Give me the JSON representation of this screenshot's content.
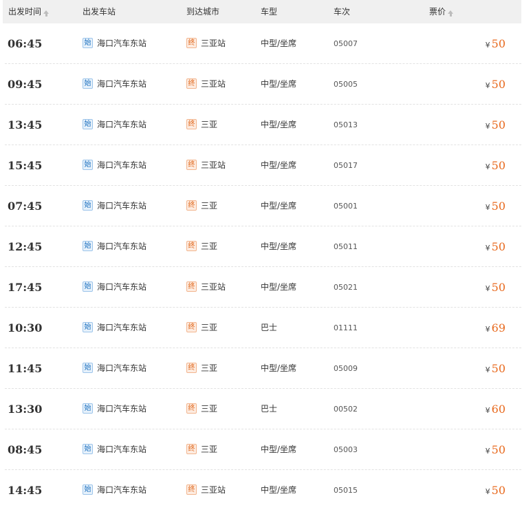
{
  "header": {
    "depart_time": "出发时间",
    "depart_station": "出发车站",
    "arrive_city": "到达城市",
    "bus_type": "车型",
    "trip_no": "车次",
    "price": "票价"
  },
  "badges": {
    "start": "始",
    "end": "终"
  },
  "currency": "¥",
  "colors": {
    "price": "#e8691d",
    "start_badge": "#1a6fbf",
    "end_badge": "#e0661a",
    "header_bg": "#f0f0f0"
  },
  "rows": [
    {
      "time": "06:45",
      "from": "海口汽车东站",
      "to": "三亚站",
      "type": "中型/坐席",
      "trip": "05007",
      "price": "50"
    },
    {
      "time": "09:45",
      "from": "海口汽车东站",
      "to": "三亚站",
      "type": "中型/坐席",
      "trip": "05005",
      "price": "50"
    },
    {
      "time": "13:45",
      "from": "海口汽车东站",
      "to": "三亚",
      "type": "中型/坐席",
      "trip": "05013",
      "price": "50"
    },
    {
      "time": "15:45",
      "from": "海口汽车东站",
      "to": "三亚站",
      "type": "中型/坐席",
      "trip": "05017",
      "price": "50"
    },
    {
      "time": "07:45",
      "from": "海口汽车东站",
      "to": "三亚",
      "type": "中型/坐席",
      "trip": "05001",
      "price": "50"
    },
    {
      "time": "12:45",
      "from": "海口汽车东站",
      "to": "三亚",
      "type": "中型/坐席",
      "trip": "05011",
      "price": "50"
    },
    {
      "time": "17:45",
      "from": "海口汽车东站",
      "to": "三亚站",
      "type": "中型/坐席",
      "trip": "05021",
      "price": "50"
    },
    {
      "time": "10:30",
      "from": "海口汽车东站",
      "to": "三亚",
      "type": "巴士",
      "trip": "01111",
      "price": "69"
    },
    {
      "time": "11:45",
      "from": "海口汽车东站",
      "to": "三亚",
      "type": "中型/坐席",
      "trip": "05009",
      "price": "50"
    },
    {
      "time": "13:30",
      "from": "海口汽车东站",
      "to": "三亚",
      "type": "巴士",
      "trip": "00502",
      "price": "60"
    },
    {
      "time": "08:45",
      "from": "海口汽车东站",
      "to": "三亚",
      "type": "中型/坐席",
      "trip": "05003",
      "price": "50"
    },
    {
      "time": "14:45",
      "from": "海口汽车东站",
      "to": "三亚站",
      "type": "中型/坐席",
      "trip": "05015",
      "price": "50"
    }
  ]
}
